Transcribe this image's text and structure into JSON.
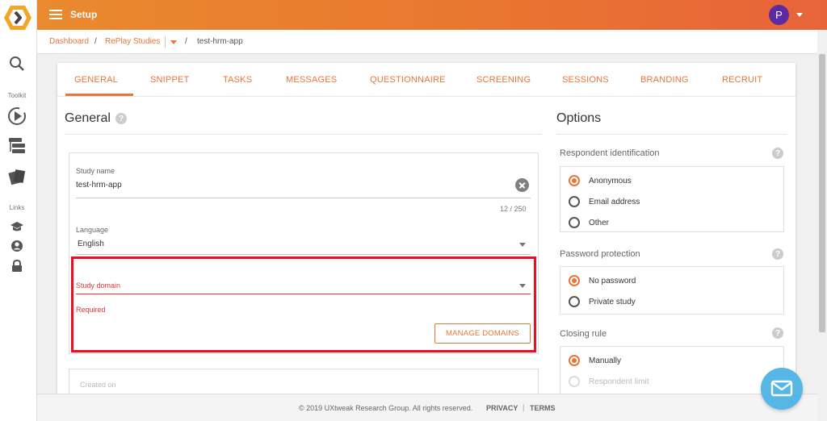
{
  "topbar": {
    "title": "Setup",
    "avatar_letter": "P"
  },
  "breadcrumb": {
    "dashboard": "Dashboard",
    "studies": "RePlay Studies",
    "current": "test-hrm-app"
  },
  "rail": {
    "toolkit_label": "Toolkit",
    "links_label": "Links"
  },
  "tabs": [
    "GENERAL",
    "SNIPPET",
    "TASKS",
    "MESSAGES",
    "QUESTIONNAIRE",
    "SCREENING",
    "SESSIONS",
    "BRANDING",
    "RECRUIT"
  ],
  "general": {
    "title": "General",
    "help": "?",
    "study_name": {
      "label": "Study name",
      "value": "test-hrm-app",
      "counter": "12 / 250"
    },
    "language": {
      "label": "Language",
      "value": "English"
    },
    "study_domain": {
      "label": "Study domain",
      "error": "Required"
    },
    "manage_domains": "MANAGE DOMAINS",
    "created_on": {
      "label": "Created on"
    }
  },
  "options": {
    "title": "Options",
    "respondent_identification": {
      "label": "Respondent identification",
      "choices": [
        "Anonymous",
        "Email address",
        "Other"
      ],
      "selected": "Anonymous"
    },
    "password_protection": {
      "label": "Password protection",
      "choices": [
        "No password",
        "Private study"
      ],
      "selected": "No password"
    },
    "closing_rule": {
      "label": "Closing rule",
      "choices": [
        "Manually",
        "Respondent limit"
      ],
      "selected": "Manually"
    }
  },
  "footer": {
    "copyright": "© 2019 UXtweak Research Group. All rights reserved.",
    "privacy": "PRIVACY",
    "separator": "|",
    "terms": "TERMS"
  },
  "colors": {
    "accent": "#e8753a",
    "error": "#e03a3a",
    "highlight": "#e81123",
    "avatar": "#5b2ca0",
    "chat": "#56b6e6"
  }
}
